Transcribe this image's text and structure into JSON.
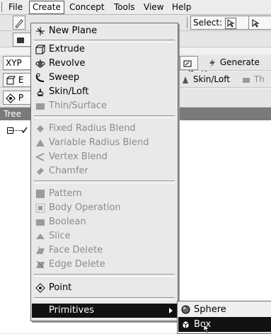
{
  "menubar": {
    "items": [
      {
        "label": "File"
      },
      {
        "label": "Create"
      },
      {
        "label": "Concept"
      },
      {
        "label": "Tools"
      },
      {
        "label": "View"
      },
      {
        "label": "Help"
      }
    ]
  },
  "toolbar": {
    "select_label": "Select:",
    "plane_value": "XYP",
    "generate_label": "Generate",
    "skin_loft_label": "Skin/Loft",
    "thin_partial": "Th",
    "extrude_partial": "E",
    "point_partial": "P"
  },
  "tree": {
    "header_partial": "Tree"
  },
  "create_menu": {
    "items": [
      {
        "label": "New Plane",
        "icon": "new-plane-icon",
        "enabled": true
      },
      {
        "label": "Extrude",
        "icon": "extrude-icon",
        "enabled": true
      },
      {
        "label": "Revolve",
        "icon": "revolve-icon",
        "enabled": true
      },
      {
        "label": "Sweep",
        "icon": "sweep-icon",
        "enabled": true
      },
      {
        "label": "Skin/Loft",
        "icon": "skin-loft-icon",
        "enabled": true
      },
      {
        "label": "Thin/Surface",
        "icon": "thin-surface-icon",
        "enabled": false
      },
      {
        "label": "Fixed Radius Blend",
        "icon": "fixed-radius-blend-icon",
        "enabled": false
      },
      {
        "label": "Variable Radius Blend",
        "icon": "variable-radius-blend-icon",
        "enabled": false
      },
      {
        "label": "Vertex Blend",
        "icon": "vertex-blend-icon",
        "enabled": false
      },
      {
        "label": "Chamfer",
        "icon": "chamfer-icon",
        "enabled": false
      },
      {
        "label": "Pattern",
        "icon": "pattern-icon",
        "enabled": false
      },
      {
        "label": "Body Operation",
        "icon": "body-operation-icon",
        "enabled": false
      },
      {
        "label": "Boolean",
        "icon": "boolean-icon",
        "enabled": false
      },
      {
        "label": "Slice",
        "icon": "slice-icon",
        "enabled": false
      },
      {
        "label": "Face Delete",
        "icon": "face-delete-icon",
        "enabled": false
      },
      {
        "label": "Edge Delete",
        "icon": "edge-delete-icon",
        "enabled": false
      },
      {
        "label": "Point",
        "icon": "point-icon",
        "enabled": true
      },
      {
        "label": "Primitives",
        "icon": "",
        "enabled": true,
        "has_submenu": true,
        "highlighted": true
      }
    ]
  },
  "primitives_menu": {
    "items": [
      {
        "label": "Sphere",
        "icon": "sphere-icon"
      },
      {
        "label": "Box",
        "icon": "box-icon",
        "highlighted": true
      }
    ]
  }
}
